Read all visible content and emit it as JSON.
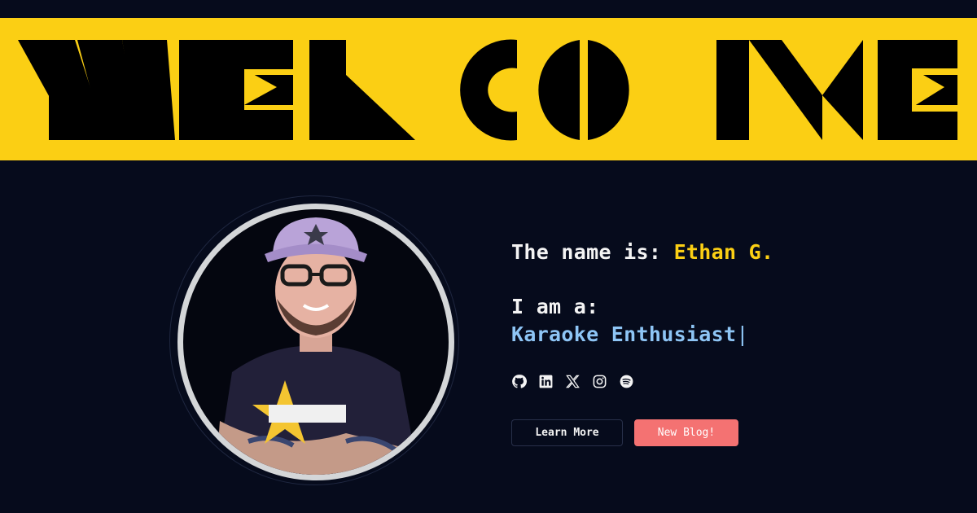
{
  "banner": {
    "text": "WELCOME",
    "background_color": "#fbcf14",
    "text_color": "#000000"
  },
  "profile": {
    "avatar_alt": "Ethan G. portrait",
    "ring_color": "#d4d6d8"
  },
  "intro": {
    "name_label": "The name is:",
    "name_value": "Ethan G.",
    "role_label": "I am a:",
    "role_value": "Karaoke Enthusiast",
    "caret": "|",
    "name_color": "#fbcf14",
    "role_color": "#8ec5f5"
  },
  "socials": [
    {
      "icon": "github-icon"
    },
    {
      "icon": "linkedin-icon"
    },
    {
      "icon": "x-icon"
    },
    {
      "icon": "instagram-icon"
    },
    {
      "icon": "spotify-icon"
    }
  ],
  "buttons": {
    "learn_more": "Learn More",
    "new_blog": "New Blog!"
  },
  "colors": {
    "page_background": "#060b1c",
    "accent_button": "#f47272"
  }
}
